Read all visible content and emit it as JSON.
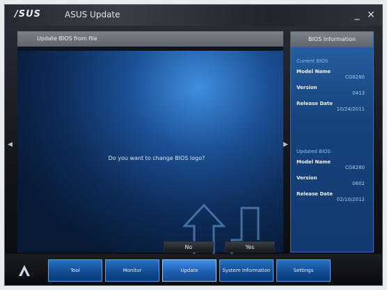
{
  "titlebar": {
    "logo": "/SUS",
    "title": "ASUS Update",
    "minimize": "_",
    "close": "×"
  },
  "main": {
    "header": "Update BIOS from file",
    "prompt": "Do you want to change BIOS logo?",
    "buttons": {
      "no": "No",
      "yes": "Yes"
    }
  },
  "info": {
    "header": "BIOS Information",
    "current": {
      "title": "Current BIOS",
      "items": [
        {
          "label": "Model Name",
          "value": "CG8280"
        },
        {
          "label": "Version",
          "value": "0413"
        },
        {
          "label": "Release Date",
          "value": "10/24/2011"
        }
      ]
    },
    "updated": {
      "title": "Updated BIOS",
      "items": [
        {
          "label": "Model Name",
          "value": "CG8280"
        },
        {
          "label": "Version",
          "value": "0602"
        },
        {
          "label": "Release Date",
          "value": "02/10/2012"
        }
      ]
    }
  },
  "nav": {
    "items": [
      {
        "label": "Tool"
      },
      {
        "label": "Monitor"
      },
      {
        "label": "Update"
      },
      {
        "label": "System Information"
      },
      {
        "label": "Settings"
      }
    ]
  }
}
